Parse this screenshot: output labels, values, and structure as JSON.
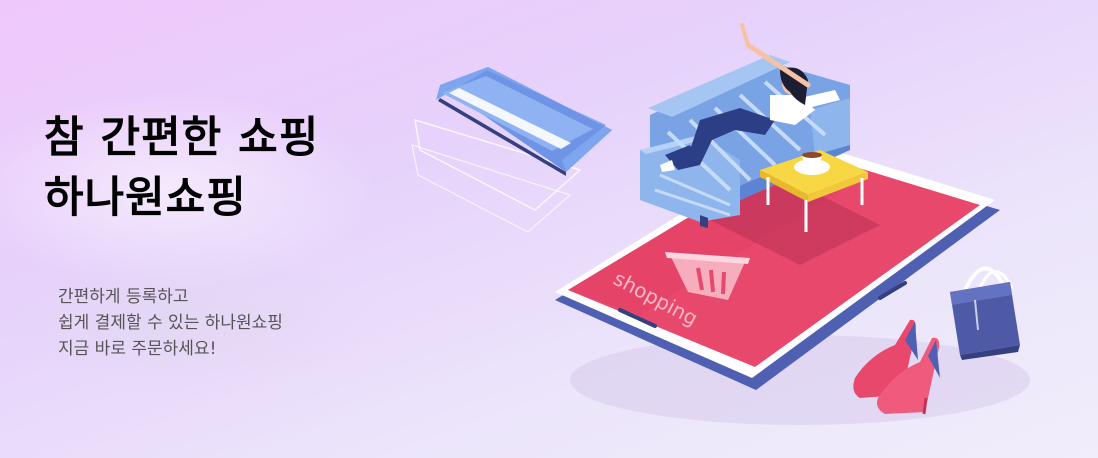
{
  "headline": [
    "참 간편한 쇼핑",
    "하나원쇼핑"
  ],
  "subtext": [
    "간편하게 등록하고",
    "쉽게 결제할 수 있는 하나원쇼핑",
    "지금 바로 주문하세요!"
  ],
  "phone_screen_text": "shopping",
  "colors": {
    "phone_screen": "#e8486c",
    "phone_body": "#5e6fbf",
    "sofa": "#8fb6ec",
    "card": "#7ea6ee",
    "table": "#f7d844",
    "heels": "#e8486c",
    "bag": "#4e5aa6"
  },
  "illustration": {
    "name": "online-shopping-illustration",
    "elements": [
      "credit-card",
      "smartphone",
      "sofa",
      "woman-relaxing",
      "coffee-table",
      "coffee-cup",
      "shopping-basket",
      "high-heels",
      "handbag"
    ]
  }
}
